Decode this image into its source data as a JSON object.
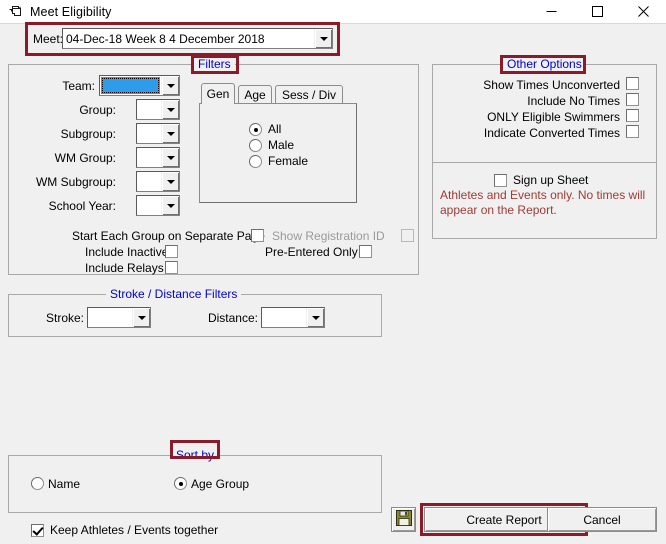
{
  "window": {
    "title": "Meet Eligibility",
    "icon": "window-restore-icon",
    "minimize_label": "—",
    "maximize_label": "☐",
    "close_label": "✕"
  },
  "meet": {
    "label": "Meet:",
    "value": "04-Dec-18 Week 8 4 December 2018"
  },
  "filters": {
    "legend": "Filters",
    "fields": [
      {
        "label": "Team:",
        "value": "",
        "selected": true
      },
      {
        "label": "Group:",
        "value": "",
        "selected": false
      },
      {
        "label": "Subgroup:",
        "value": "",
        "selected": false
      },
      {
        "label": "WM Group:",
        "value": "",
        "selected": false
      },
      {
        "label": "WM Subgroup:",
        "value": "",
        "selected": false
      },
      {
        "label": "School Year:",
        "value": "",
        "selected": false
      }
    ],
    "checks": [
      {
        "label": "Start Each Group on Separate Page",
        "checked": false,
        "disabled": false
      },
      {
        "label": "Include Inactive",
        "checked": false,
        "disabled": false
      },
      {
        "label": "Include Relays",
        "checked": false,
        "disabled": false
      },
      {
        "label": "Show Registration ID",
        "checked": false,
        "disabled": true
      },
      {
        "label": "Pre-Entered Only",
        "checked": false,
        "disabled": false
      }
    ],
    "tabs": [
      {
        "label": "Gen",
        "active": true
      },
      {
        "label": "Age",
        "active": false
      },
      {
        "label": "Sess / Div",
        "active": false
      }
    ],
    "gender_options": [
      {
        "label": "All",
        "selected": true
      },
      {
        "label": "Male",
        "selected": false
      },
      {
        "label": "Female",
        "selected": false
      }
    ]
  },
  "other_options": {
    "legend": "Other Options",
    "checks": [
      {
        "label": "Show Times Unconverted",
        "checked": false
      },
      {
        "label": "Include No Times",
        "checked": false
      },
      {
        "label": "ONLY Eligible Swimmers",
        "checked": false
      },
      {
        "label": "Indicate Converted Times",
        "checked": false
      }
    ],
    "signup": {
      "label": "Sign up Sheet",
      "checked": false,
      "note_line1": "Athletes and Events only.  No times will",
      "note_line2": "appear on the Report."
    }
  },
  "stroke_distance": {
    "legend": "Stroke / Distance Filters",
    "stroke_label": "Stroke:",
    "stroke_value": "",
    "distance_label": "Distance:",
    "distance_value": ""
  },
  "sort_by": {
    "legend": "Sort by",
    "options": [
      {
        "label": "Name",
        "selected": false
      },
      {
        "label": "Age Group",
        "selected": true
      }
    ],
    "keep_together": {
      "label": "Keep Athletes / Events together",
      "checked": true
    }
  },
  "actions": {
    "save_icon": "floppy-save-icon",
    "create_report": "Create Report",
    "cancel": "Cancel"
  },
  "colors": {
    "marker": "#8b1a2b",
    "legend_text": "#0000d0",
    "note_text": "#9e3b34",
    "selection": "#2f9ceb",
    "window_bg": "#f0f0f0"
  }
}
